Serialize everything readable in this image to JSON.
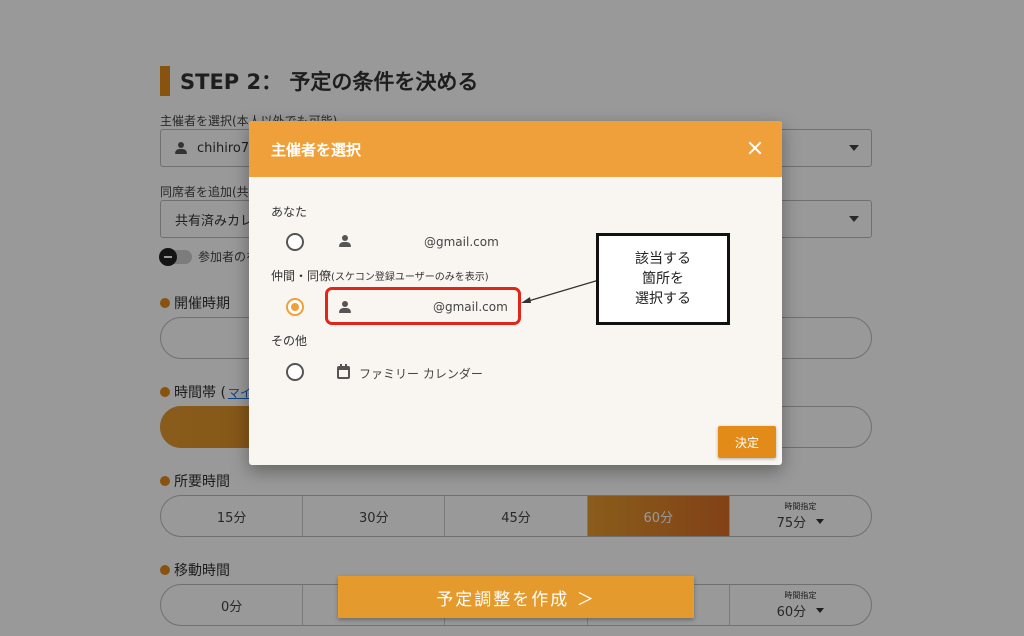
{
  "page": {
    "step_title": "STEP 2： 予定の条件を決める",
    "organizer_label": "主催者を選択(本人以外でも可能)",
    "organizer_value": "chihiro7",
    "attendee_label": "同席者を追加(共",
    "attendee_value": "共有済みカレ",
    "toggle_label": "参加者のを",
    "period_label": "開催時期",
    "timeslot_label": "時間帯 (",
    "timeslot_link": "マイ",
    "duration_label": "所要時間",
    "duration_options": [
      "15分",
      "30分",
      "45分",
      "60分"
    ],
    "duration_custom_small": "時間指定",
    "duration_custom_value": "75分",
    "duration_selected": "60分",
    "travel_label": "移動時間",
    "travel_options": [
      "0分"
    ],
    "travel_custom_small": "時間指定",
    "travel_custom_value": "60分",
    "create_button": "予定調整を作成 ＞"
  },
  "modal": {
    "title": "主催者を選択",
    "group_you": "あなた",
    "you_email": "@gmail.com",
    "group_peers": "仲間・同僚",
    "group_peers_note": "(スケコン登録ユーザーのみを表示)",
    "peer_email": "@gmail.com",
    "group_other": "その他",
    "other_calendar": "ファミリー カレンダー",
    "selected_option": "peer",
    "confirm_button": "決定"
  },
  "annotation": {
    "text": "該当する\n箇所を\n選択する"
  },
  "colors": {
    "accent": "#f0a03a",
    "highlight_red": "#e0261b"
  }
}
